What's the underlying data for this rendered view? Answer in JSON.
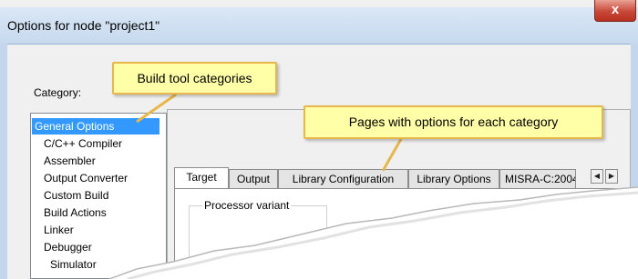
{
  "window": {
    "title": "Options for node \"project1\"",
    "close_glyph": "x"
  },
  "category": {
    "label": "Category:",
    "items": [
      {
        "label": "General Options",
        "selected": true
      },
      {
        "label": "C/C++ Compiler"
      },
      {
        "label": "Assembler"
      },
      {
        "label": "Output Converter"
      },
      {
        "label": "Custom Build"
      },
      {
        "label": "Build Actions"
      },
      {
        "label": "Linker"
      },
      {
        "label": "Debugger"
      },
      {
        "label": "Simulator"
      }
    ]
  },
  "tabs": [
    {
      "label": "Target",
      "active": true
    },
    {
      "label": "Output"
    },
    {
      "label": "Library Configuration"
    },
    {
      "label": "Library Options"
    },
    {
      "label": "MISRA-C:2004"
    }
  ],
  "page": {
    "group_label": "Processor variant"
  },
  "scroll_buttons": {
    "left": "◀",
    "right": "▶"
  },
  "callouts": {
    "categories": "Build tool categories",
    "pages": "Pages with options for each category"
  },
  "colors": {
    "selection": "#3399ff",
    "callout_fill": "#ffffa8",
    "callout_border": "#e7b74c",
    "close_button": "#c9483a"
  }
}
